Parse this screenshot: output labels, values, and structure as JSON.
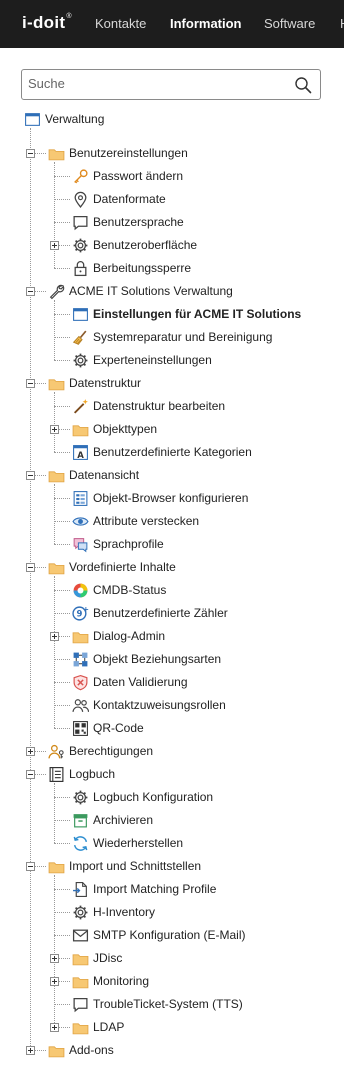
{
  "header": {
    "logo": "i-doit",
    "nav": [
      "Kontakte",
      "Information",
      "Software",
      "H"
    ]
  },
  "search": {
    "placeholder": "Suche"
  },
  "tree": {
    "root": "Verwaltung",
    "items": [
      {
        "label": "Benutzereinstellungen",
        "icon": "folder-icon"
      },
      {
        "label": "Passwort ändern",
        "icon": "key-icon"
      },
      {
        "label": "Datenformate",
        "icon": "location-pin-icon"
      },
      {
        "label": "Benutzersprache",
        "icon": "speech-bubble-icon"
      },
      {
        "label": "Benutzeroberfläche",
        "icon": "gear-icon"
      },
      {
        "label": "Berbeitungssperre",
        "icon": "lock-icon"
      },
      {
        "label": "ACME IT Solutions Verwaltung",
        "icon": "wrench-icon"
      },
      {
        "label": "Einstellungen für ACME IT Solutions",
        "icon": "window-icon"
      },
      {
        "label": "Systemreparatur und Bereinigung",
        "icon": "broom-icon"
      },
      {
        "label": "Experteneinstellungen",
        "icon": "gear-icon"
      },
      {
        "label": "Datenstruktur",
        "icon": "folder-icon"
      },
      {
        "label": "Datenstruktur bearbeiten",
        "icon": "magic-wand-icon"
      },
      {
        "label": "Objekttypen",
        "icon": "folder-icon"
      },
      {
        "label": "Benutzerdefinierte Kategorien",
        "icon": "custom-category-icon"
      },
      {
        "label": "Datenansicht",
        "icon": "folder-icon"
      },
      {
        "label": "Objekt-Browser konfigurieren",
        "icon": "object-browser-icon"
      },
      {
        "label": "Attribute verstecken",
        "icon": "eye-icon"
      },
      {
        "label": "Sprachprofile",
        "icon": "language-profile-icon"
      },
      {
        "label": "Vordefinierte Inhalte",
        "icon": "folder-icon"
      },
      {
        "label": "CMDB-Status",
        "icon": "color-wheel-icon"
      },
      {
        "label": "Benutzerdefinierte Zähler",
        "icon": "counter-icon"
      },
      {
        "label": "Dialog-Admin",
        "icon": "folder-icon"
      },
      {
        "label": "Objekt Beziehungsarten",
        "icon": "relation-icon"
      },
      {
        "label": "Daten Validierung",
        "icon": "shield-x-icon"
      },
      {
        "label": "Kontaktzuweisungsrollen",
        "icon": "users-icon"
      },
      {
        "label": "QR-Code",
        "icon": "qr-code-icon"
      },
      {
        "label": "Berechtigungen",
        "icon": "user-key-icon"
      },
      {
        "label": "Logbuch",
        "icon": "logbook-icon"
      },
      {
        "label": "Logbuch Konfiguration",
        "icon": "gear-icon"
      },
      {
        "label": "Archivieren",
        "icon": "archive-icon"
      },
      {
        "label": "Wiederherstellen",
        "icon": "refresh-icon"
      },
      {
        "label": "Import und Schnittstellen",
        "icon": "folder-icon"
      },
      {
        "label": "Import Matching Profile",
        "icon": "import-icon"
      },
      {
        "label": "H-Inventory",
        "icon": "gear-icon"
      },
      {
        "label": "SMTP Konfiguration (E-Mail)",
        "icon": "envelope-icon"
      },
      {
        "label": "JDisc",
        "icon": "folder-icon"
      },
      {
        "label": "Monitoring",
        "icon": "folder-icon"
      },
      {
        "label": "TroubleTicket-System (TTS)",
        "icon": "speech-bubble-icon"
      },
      {
        "label": "LDAP",
        "icon": "folder-icon"
      },
      {
        "label": "Add-ons",
        "icon": "folder-icon"
      }
    ]
  },
  "colors": {
    "header_bg": "#1d1d1d",
    "folder": "#f7c873",
    "accent_blue": "#2f6fb8"
  }
}
